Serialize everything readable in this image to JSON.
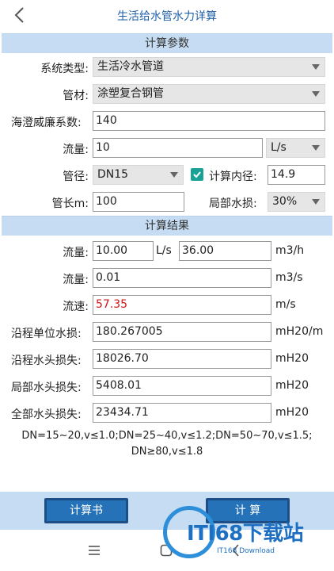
{
  "header": {
    "title": "生活给水管水力详算"
  },
  "params_section": {
    "title": "计算参数",
    "system_type": {
      "label": "系统类型:",
      "value": "生活冷水管道"
    },
    "pipe_material": {
      "label": "管材:",
      "value": "涂塑复合钢管"
    },
    "hazen_williams": {
      "label": "海澄威廉系数:",
      "value": "140"
    },
    "flow": {
      "label": "流量:",
      "value": "10",
      "unit": "L/s"
    },
    "diameter": {
      "label": "管径:",
      "value": "DN15"
    },
    "inner_diameter": {
      "label": "计算内径:",
      "value": "14.9",
      "checked": true
    },
    "pipe_length": {
      "label": "管长m:",
      "value": "100"
    },
    "local_loss": {
      "label": "局部水损:",
      "value": "30%"
    }
  },
  "results_section": {
    "title": "计算结果",
    "flow_ls": {
      "label": "流量:",
      "value": "10.00",
      "unit": "L/s"
    },
    "flow_m3h": {
      "value": "36.00",
      "unit": "m3/h"
    },
    "flow_m3s": {
      "label": "流量:",
      "value": "0.01",
      "unit": "m3/s"
    },
    "velocity": {
      "label": "流速:",
      "value": "57.35",
      "unit": "m/s",
      "color": "#d01515"
    },
    "unit_loss": {
      "label": "沿程单位水损:",
      "value": "180.267005",
      "unit": "mH20/m"
    },
    "friction_loss": {
      "label": "沿程水头损失:",
      "value": "18026.70",
      "unit": "mH20"
    },
    "local_head_loss": {
      "label": "局部水头损失:",
      "value": "5408.01",
      "unit": "mH20"
    },
    "total_loss": {
      "label": "全部水头损失:",
      "value": "23434.71",
      "unit": "mH20"
    }
  },
  "note": {
    "line1": "DN=15~20,v≤1.0;DN=25~40,v≤1.2;DN=50~70,v≤1.5;",
    "line2": "DN≥80,v≤1.8"
  },
  "buttons": {
    "report": "计算书",
    "calculate": "计 算"
  },
  "watermark": {
    "brand": "ITI68下载站",
    "sub": "IT168 Download"
  },
  "colors": {
    "accent": "#2672b8",
    "section_bg": "#c5dcf2",
    "title": "#1f5fa8",
    "check": "#1aa296"
  },
  "icons": {
    "back": "chevron-left-icon",
    "menu": "menu-icon",
    "home": "home-icon",
    "nav_back": "nav-back-icon"
  }
}
